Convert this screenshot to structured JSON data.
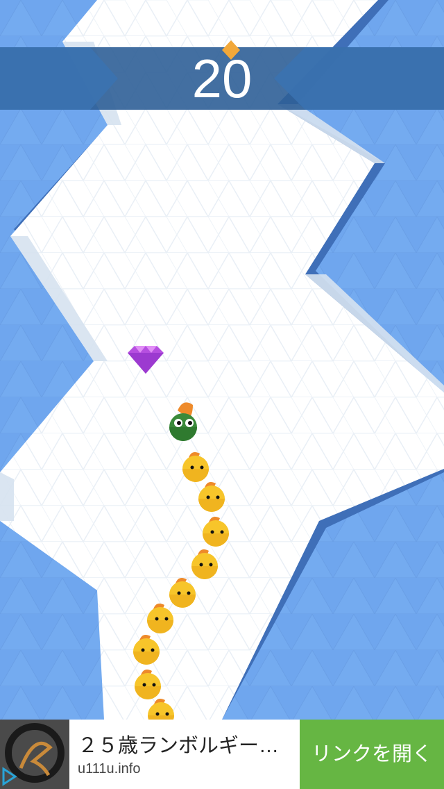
{
  "game": {
    "score": "20",
    "colors": {
      "wall": "#6fa6ee",
      "wall_shadow": "#3f6fb8",
      "path": "#ffffff",
      "path_shade": "#d8e4f1",
      "banner": "#2f5f97",
      "chick": "#f7c52a",
      "chick_crest": "#ee8a2a",
      "snake_head": "#3a8a3a",
      "gem": "#b64fe0"
    },
    "icons": [
      "diamond-gem-icon",
      "snake-head-icon",
      "chick-icon"
    ]
  },
  "ad": {
    "title": "２５歳ランボルギーニ…",
    "domain": "u111u.info",
    "button_label": "リンクを開く",
    "colors": {
      "button": "#66b643"
    }
  }
}
